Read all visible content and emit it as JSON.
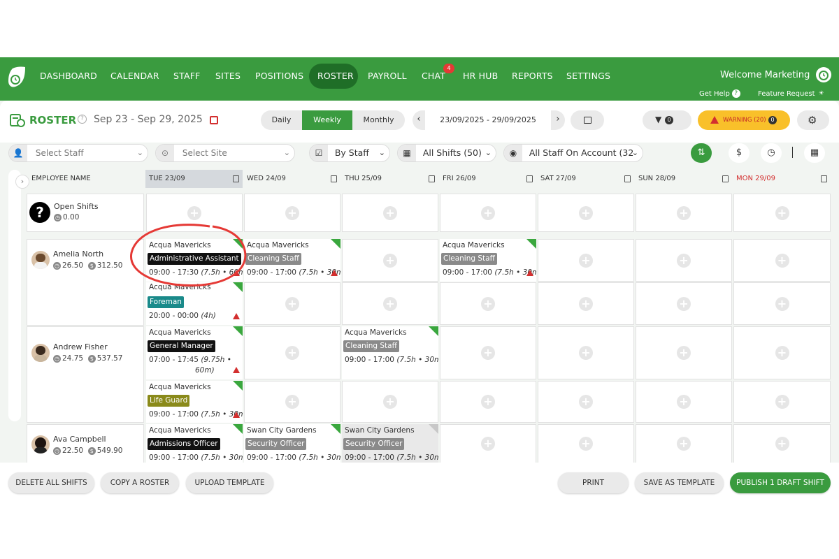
{
  "nav": {
    "items": [
      "DASHBOARD",
      "CALENDAR",
      "STAFF",
      "SITES",
      "POSITIONS",
      "ROSTER",
      "PAYROLL",
      "CHAT",
      "HR HUB",
      "REPORTS",
      "SETTINGS"
    ],
    "chat_badge": "4",
    "welcome": "Welcome Marketing",
    "get_help": "Get Help",
    "feature_request": "Feature Request",
    "accent": "#3a9b3f"
  },
  "toolbar": {
    "title": "ROSTER",
    "date_range": "Sep 23 - Sep 29, 2025",
    "views": [
      "Daily",
      "Weekly",
      "Monthly"
    ],
    "active_view": "Weekly",
    "date_input": "23/09/2025 - 29/09/2025",
    "filter_count": "0",
    "warning_label": "WARNING (20)",
    "warning_count": "0"
  },
  "filters": {
    "select_staff": "Select Staff",
    "select_site": "Select Site",
    "group_by": "By Staff",
    "shifts": "All Shifts (50)",
    "staff_scope": "All Staff On Account (32"
  },
  "grid": {
    "employee_header": "EMPLOYEE NAME",
    "days": [
      {
        "label": "TUE 23/09",
        "color": "#333"
      },
      {
        "label": "WED 24/09",
        "color": "#333"
      },
      {
        "label": "THU 25/09",
        "color": "#333"
      },
      {
        "label": "FRI 26/09",
        "color": "#333"
      },
      {
        "label": "SAT 27/09",
        "color": "#333"
      },
      {
        "label": "SUN 28/09",
        "color": "#333"
      },
      {
        "label": "MON 29/09",
        "color": "#d32f2f"
      }
    ],
    "open_shifts": {
      "name": "Open Shifts",
      "hours": "0.00"
    },
    "employees": [
      {
        "name": "Amelia North",
        "hours": "26.50",
        "cost": "312.50"
      },
      {
        "name": "Andrew Fisher",
        "hours": "24.75",
        "cost": "537.57"
      },
      {
        "name": "Ava Campbell",
        "hours": "22.50",
        "cost": "549.90"
      }
    ],
    "shifts": [
      {
        "site": "Acqua Mavericks",
        "role": "Administrative Assistant",
        "role_color": "#111111",
        "time": "09:00 - 17:30",
        "meta": "(7.5h • 60m)"
      },
      {
        "site": "Acqua Mavericks",
        "role": "Cleaning Staff",
        "role_color": "#8a8a8a",
        "time": "09:00 - 17:00",
        "meta": "(7.5h • 30m)"
      },
      {
        "site": "Acqua Mavericks",
        "role": "Cleaning Staff",
        "role_color": "#8a8a8a",
        "time": "09:00 - 17:00",
        "meta": "(7.5h • 30m)"
      },
      {
        "site": "Acqua Mavericks",
        "role": "Foreman",
        "role_color": "#1a8a8a",
        "time": "20:00 - 00:00",
        "meta": "(4h)"
      },
      {
        "site": "Acqua Mavericks",
        "role": "General Manager",
        "role_color": "#111111",
        "time": "07:00 - 17:45",
        "meta": "(9.75h •",
        "meta2": "60m)"
      },
      {
        "site": "Acqua Mavericks",
        "role": "Cleaning Staff",
        "role_color": "#8a8a8a",
        "time": "09:00 - 17:00",
        "meta": "(7.5h • 30m)"
      },
      {
        "site": "Acqua Mavericks",
        "role": "Life Guard",
        "role_color": "#8a8a1a",
        "time": "09:00 - 17:00",
        "meta": "(7.5h • 30m)"
      },
      {
        "site": "Acqua Mavericks",
        "role": "Admissions Officer",
        "role_color": "#111111",
        "time": "09:00 - 17:00",
        "meta": "(7.5h • 30m)"
      },
      {
        "site": "Swan City Gardens",
        "role": "Security Officer",
        "role_color": "#8a8a8a",
        "time": "09:00 - 17:00",
        "meta": "(7.5h • 30m)"
      },
      {
        "site": "Swan City Gardens",
        "role": "Security Officer",
        "role_color": "#8a8a8a",
        "time": "09:00 - 17:00",
        "meta": "(7.5h • 30m)"
      }
    ]
  },
  "footer": {
    "delete_all": "DELETE ALL SHIFTS",
    "copy_roster": "COPY A ROSTER",
    "upload_template": "UPLOAD TEMPLATE",
    "print": "PRINT",
    "save_template": "SAVE AS TEMPLATE",
    "publish": "PUBLISH 1 DRAFT SHIFT"
  }
}
